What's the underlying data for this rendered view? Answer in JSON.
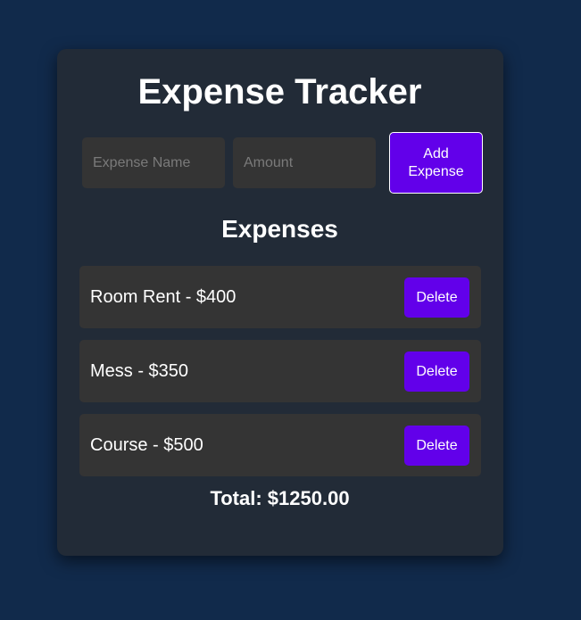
{
  "app": {
    "title": "Expense Tracker"
  },
  "form": {
    "name_placeholder": "Expense Name",
    "name_value": "",
    "amount_placeholder": "Amount",
    "amount_value": "",
    "add_label": "Add Expense"
  },
  "list": {
    "heading": "Expenses",
    "items": [
      {
        "label": "Room Rent - $400",
        "delete_label": "Delete"
      },
      {
        "label": "Mess - $350",
        "delete_label": "Delete"
      },
      {
        "label": "Course - $500",
        "delete_label": "Delete"
      }
    ]
  },
  "summary": {
    "total_text": "Total: $1250.00"
  },
  "colors": {
    "page_background": "#112a4b",
    "card_background": "#222b37",
    "field_background": "#343434",
    "accent": "#6200ea",
    "text": "#ffffff"
  }
}
